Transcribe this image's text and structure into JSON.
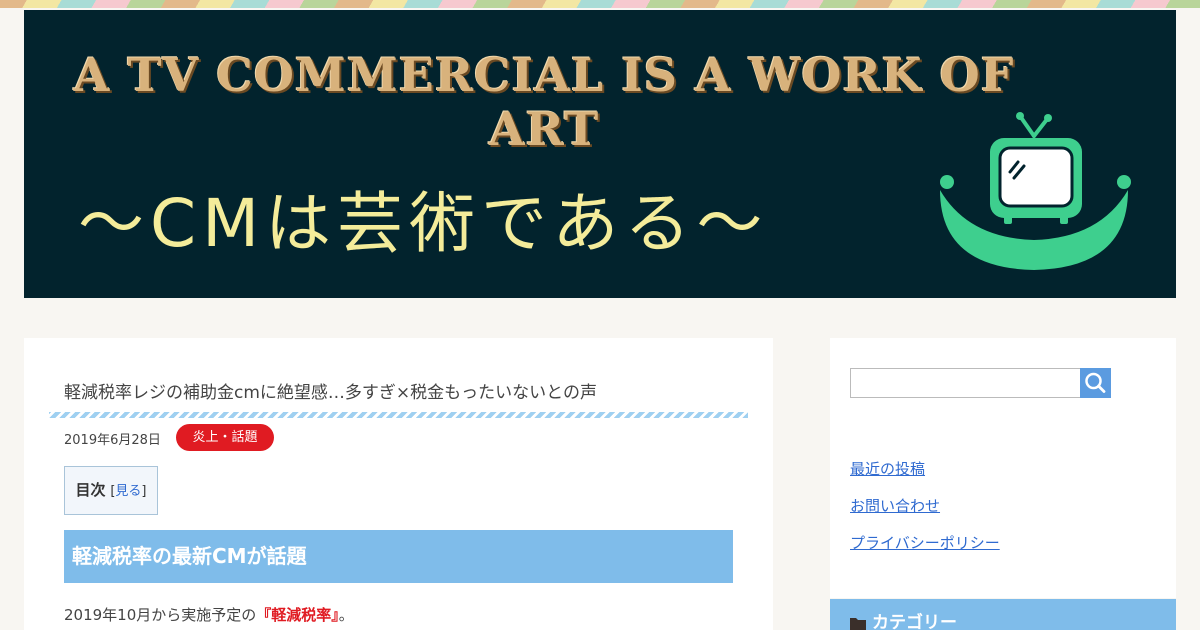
{
  "header": {
    "banner_title": "A TV COMMERCIAL IS A WORK OF ART",
    "banner_subtitle": "～CMは芸術である～"
  },
  "article": {
    "title": "軽減税率レジの補助金cmに絶望感…多すぎ×税金もったいないとの声",
    "date": "2019年6月28日",
    "category": "炎上・話題",
    "toc": {
      "title": "目次",
      "bracket_open": "[",
      "toggle": "見る",
      "bracket_close": "]"
    },
    "section_heading": "軽減税率の最新CMが話題",
    "body": {
      "prefix": "2019年10月から実施予定の",
      "highlight": "『軽減税率』",
      "suffix": "。"
    }
  },
  "sidebar": {
    "search_placeholder": "",
    "links": [
      "最近の投稿",
      "お問い合わせ",
      "プライバシーポリシー"
    ],
    "category_header": "カテゴリー"
  },
  "colors": {
    "accent_blue": "#7fbcea",
    "badge_red": "#e01b22",
    "link_blue": "#2f6ad0",
    "banner_bg": "#02232d",
    "tv_green": "#3ecf8e"
  }
}
